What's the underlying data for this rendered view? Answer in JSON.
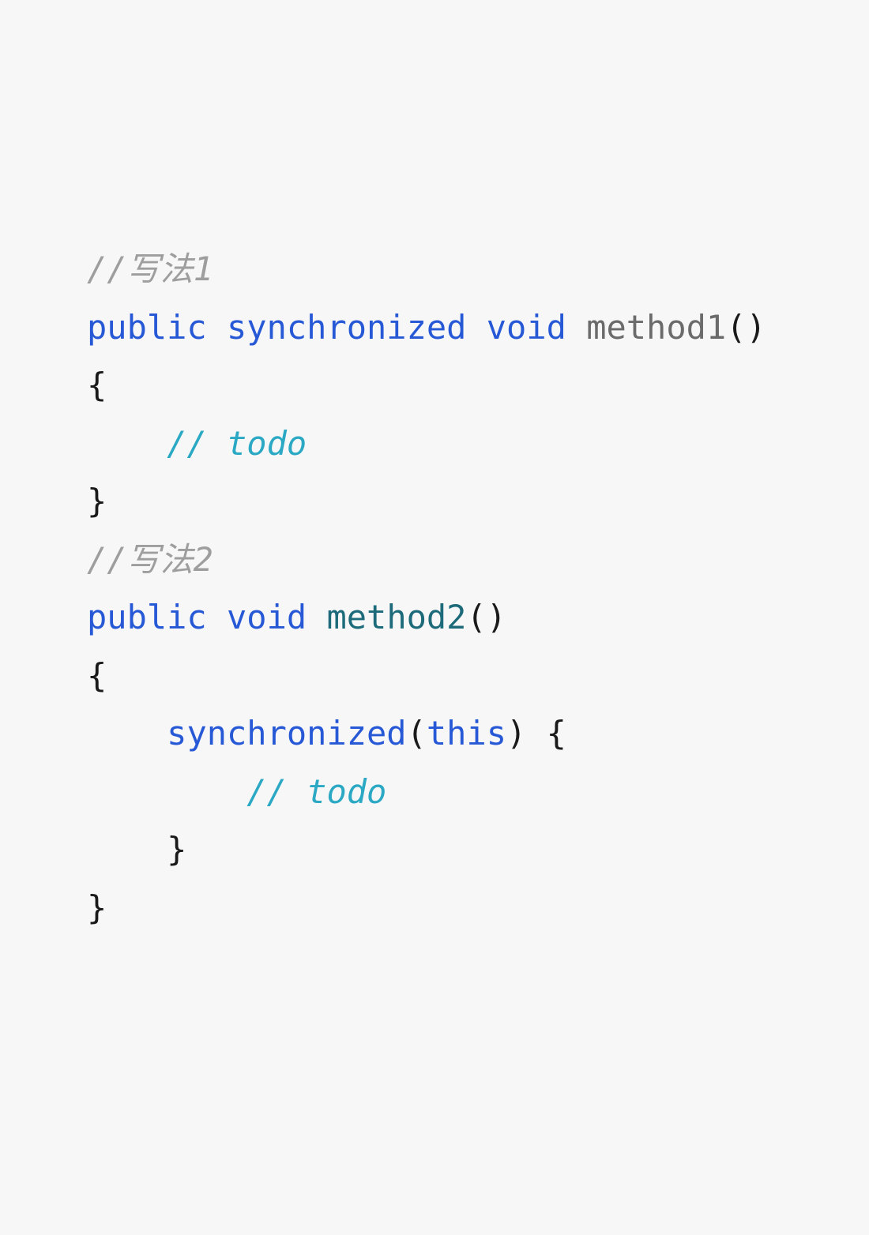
{
  "code": {
    "comment1": "//写法1",
    "kw_public": "public",
    "kw_synchronized": "synchronized",
    "kw_void": "void",
    "method1": "method1",
    "parens": "()",
    "open_brace": "{",
    "close_brace": "}",
    "todo_comment": "// todo",
    "comment2": "//写法2",
    "method2": "method2",
    "kw_this": "this",
    "sync_open": "synchronized(",
    "sync_close": ") {"
  }
}
